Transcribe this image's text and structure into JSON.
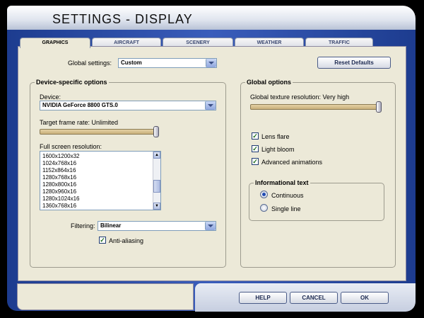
{
  "window": {
    "title": "SETTINGS - DISPLAY"
  },
  "tabs": [
    {
      "label": "GRAPHICS",
      "active": true
    },
    {
      "label": "AIRCRAFT"
    },
    {
      "label": "SCENERY"
    },
    {
      "label": "WEATHER"
    },
    {
      "label": "TRAFFIC"
    }
  ],
  "global_settings": {
    "label": "Global settings:",
    "value": "Custom"
  },
  "reset_defaults": "Reset Defaults",
  "device_group": {
    "title": "Device-specific options",
    "device_label": "Device:",
    "device_value": "NVIDIA GeForce 8800 GTS.0",
    "frame_rate_label": "Target frame rate: Unlimited",
    "frame_rate_level": 1.0,
    "resolution_label": "Full screen resolution:",
    "resolutions": [
      "1600x1200x32",
      "1024x768x16",
      "1152x864x16",
      "1280x768x16",
      "1280x800x16",
      "1280x960x16",
      "1280x1024x16",
      "1360x768x16"
    ],
    "filtering_label": "Filtering:",
    "filtering_value": "Bilinear",
    "anti_aliasing_label": "Anti-aliasing",
    "anti_aliasing_checked": true
  },
  "global_group": {
    "title": "Global options",
    "texture_label": "Global texture resolution: Very high",
    "texture_level": 1.0,
    "lens_flare": "Lens flare",
    "light_bloom": "Light bloom",
    "advanced_animations": "Advanced animations",
    "info_title": "Informational text",
    "continuous": "Continuous",
    "single_line": "Single line",
    "selected_info": "Continuous"
  },
  "buttons": {
    "help": "HELP",
    "cancel": "CANCEL",
    "ok": "OK"
  }
}
